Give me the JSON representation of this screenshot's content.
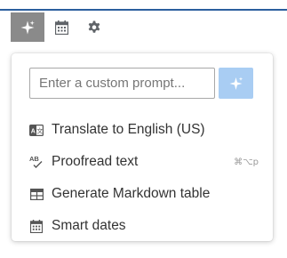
{
  "accent_color": "#2b5f9e",
  "toolbar": {
    "buttons": [
      {
        "icon": "sparkles-icon",
        "active": true
      },
      {
        "icon": "calendar-icon",
        "active": false
      },
      {
        "icon": "gear-icon",
        "active": false
      }
    ]
  },
  "popover": {
    "prompt_placeholder": "Enter a custom prompt...",
    "submit_icon": "sparkles-icon",
    "items": [
      {
        "label": "Translate to English (US)",
        "icon": "translate-icon",
        "shortcut": ""
      },
      {
        "label": "Proofread text",
        "icon": "spellcheck-icon",
        "shortcut": "⌘⌥p"
      },
      {
        "label": "Generate Markdown table",
        "icon": "table-icon",
        "shortcut": ""
      },
      {
        "label": "Smart dates",
        "icon": "calendar-icon",
        "shortcut": ""
      }
    ]
  }
}
